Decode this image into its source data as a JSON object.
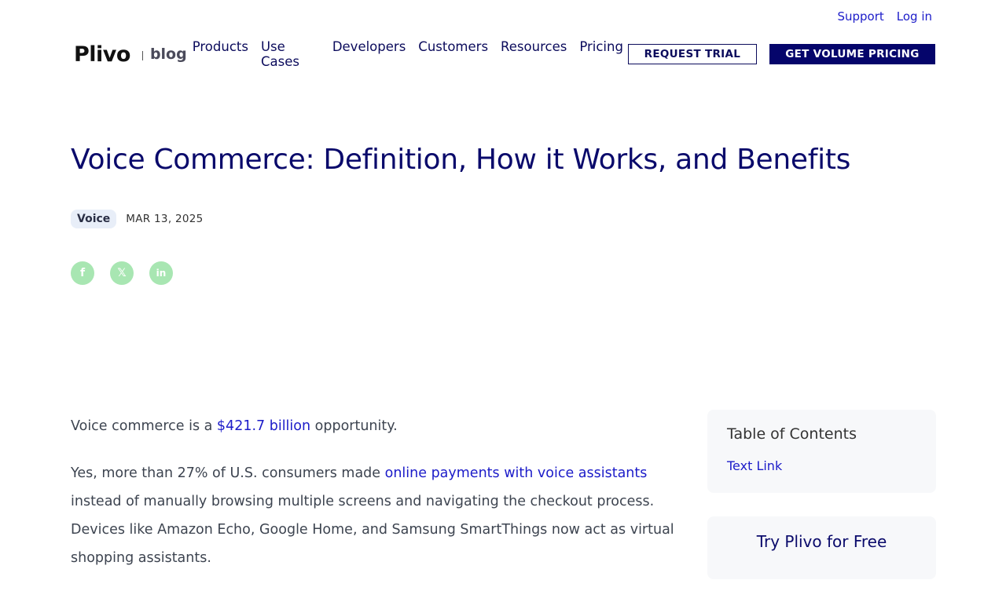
{
  "topbar": {
    "support": "Support",
    "login": "Log in"
  },
  "brand": {
    "logo": "Plivo",
    "blog": "blog"
  },
  "nav": {
    "items": [
      {
        "label": "Products"
      },
      {
        "label": "Use Cases"
      },
      {
        "label": "Developers"
      },
      {
        "label": "Customers"
      },
      {
        "label": "Resources"
      },
      {
        "label": "Pricing"
      }
    ],
    "request_trial": "REQUEST TRIAL",
    "volume_pricing": "GET VOLUME PRICING"
  },
  "article": {
    "title": "Voice Commerce: Definition, How it Works, and Benefits",
    "tag": "Voice",
    "date": "MAR 13, 2025",
    "p1_before": "Voice commerce is a ",
    "p1_link": "$421.7 billion",
    "p1_after": " opportunity.",
    "p2_before": "Yes, more than 27% of U.S. consumers made ",
    "p2_link": "online payments with voice assistants",
    "p2_after": " instead of manually browsing multiple screens and navigating the checkout process. Devices like Amazon Echo, Google Home, and Samsung SmartThings now act as virtual shopping assistants."
  },
  "share": {
    "facebook": "f",
    "x": "𝕏",
    "linkedin": "in"
  },
  "sidebar": {
    "toc_title": "Table of Contents",
    "toc_link": "Text Link",
    "try_title": "Try Plivo for Free"
  },
  "colors": {
    "brand_navy": "#05056b",
    "link_blue": "#1c1cc9",
    "share_green": "#a8e6b2"
  }
}
